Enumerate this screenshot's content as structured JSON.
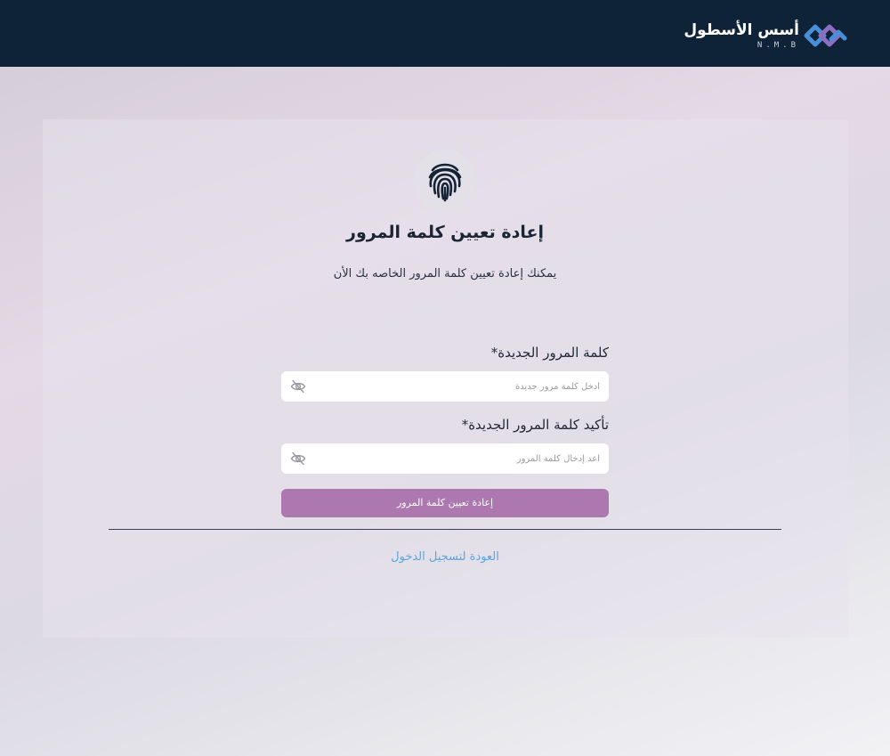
{
  "header": {
    "brand_name": "أسس الأسطول",
    "brand_sub": "N.M.B",
    "icons": {
      "logo": "brand-logo-mark"
    }
  },
  "card": {
    "icon": "fingerprint-icon",
    "title": "إعادة تعيين كلمة المرور",
    "subtitle": "يمكنك إعادة تعيين كلمة المرور الخاصه بك الأن"
  },
  "form": {
    "new_password": {
      "label": "كلمة المرور الجديدة*",
      "placeholder": "أدخل كلمة مرور جديدة",
      "value": "",
      "icon": "eye-off-icon"
    },
    "confirm_password": {
      "label": "تأكيد كلمة المرور الجديدة*",
      "placeholder": "أعد إدخال كلمة المرور",
      "value": "",
      "icon": "eye-off-icon"
    },
    "submit_label": "إعادة تعيين كلمة المرور",
    "back_link": "العودة لتسجيل الدخول"
  },
  "colors": {
    "header_bg": "#0e2238",
    "button_bg": "#ad77b0",
    "link": "#5aa6dd",
    "logo_accent_1": "#4a8fd6",
    "logo_accent_2": "#8d6fc1"
  }
}
